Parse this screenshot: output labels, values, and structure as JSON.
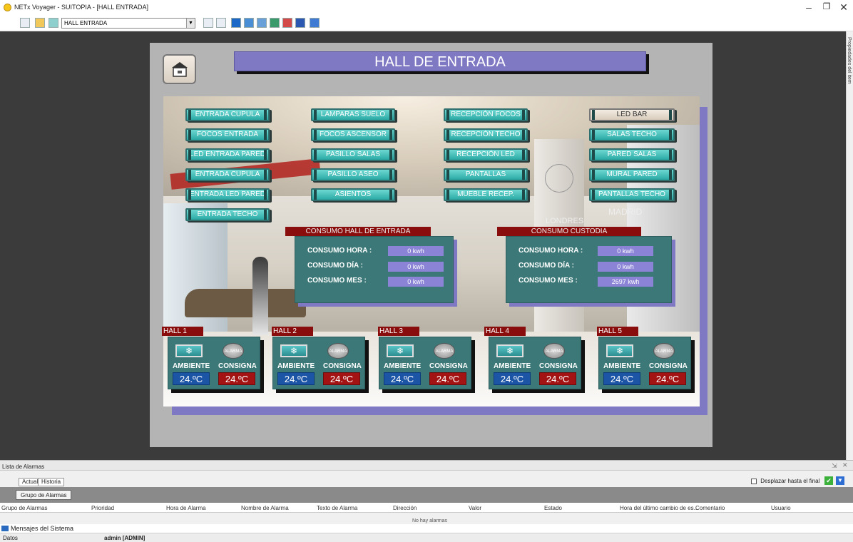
{
  "window": {
    "title": "NETx Voyager - SUITOPIA - [HALL ENTRADA]"
  },
  "toolbar": {
    "page_select": "HALL ENTRADA"
  },
  "sidebar_right": {
    "label": "Propiedades del item"
  },
  "screen": {
    "title": "HALL DE ENTRADA",
    "lights": [
      "ENTRADA CUPULA",
      "FOCOS ENTRADA",
      "LED ENTRADA PARED",
      "ENTRADA CUPULA",
      "ENTRADA LED PARED",
      "ENTRADA TECHO",
      "LAMPARAS SUELO",
      "FOCOS ASCENSOR",
      "PASILLO SALAS",
      "PASILLO ASEO",
      "ASIENTOS",
      "RECEPCIÓN FOCOS",
      "RECEPCIÓN TECHO",
      "RECEPCIÓN LED",
      "PANTALLAS",
      "MUEBLE RECEP.",
      "LED BAR",
      "SALAS TECHO",
      "PARED SALAS",
      "MURAL PARED",
      "PANTALLAS TECHO"
    ],
    "signs": {
      "londres": "LONDRES",
      "madrid": "MADRID"
    },
    "consumo_hall": {
      "title": "CONSUMO HALL DE ENTRADA",
      "labels": [
        "CONSUMO HORA :",
        "CONSUMO DÍA :",
        "CONSUMO MES :"
      ],
      "values": [
        "0 kwh",
        "0 kwh",
        "0 kwh"
      ]
    },
    "consumo_custodia": {
      "title": "CONSUMO CUSTODIA",
      "labels": [
        "CONSUMO HORA :",
        "CONSUMO DÍA :",
        "CONSUMO MES :"
      ],
      "values": [
        "0 kwh",
        "0 kwh",
        "2697 kwh"
      ]
    },
    "halls": [
      {
        "name": "HALL 1",
        "ambiente": "24.ºC",
        "consigna": "24.ºC"
      },
      {
        "name": "HALL 2",
        "ambiente": "24.ºC",
        "consigna": "24.ºC"
      },
      {
        "name": "HALL 3",
        "ambiente": "24.ºC",
        "consigna": "24.ºC"
      },
      {
        "name": "HALL 4",
        "ambiente": "24.ºC",
        "consigna": "24.ºC"
      },
      {
        "name": "HALL 5",
        "ambiente": "24.ºC",
        "consigna": "24.ºC"
      }
    ],
    "hall_labels": {
      "ambiente": "AMBIENTE",
      "consigna": "CONSIGNA",
      "alarm": "ALARMA"
    }
  },
  "alarm_pane": {
    "title": "Lista de Alarmas",
    "tabs": [
      "Actual",
      "Historia"
    ],
    "scroll_label": "Desplazar hasta el final",
    "group_tag": "Grupo de Alarmas",
    "columns": [
      "Grupo de Alarmas",
      "Prioridad",
      "Hora de Alarma",
      "Nombre de Alarma",
      "Texto de Alarma",
      "Dirección",
      "Valor",
      "Estado",
      "Hora del último cambio de es...",
      "Comentario",
      "Usuario"
    ],
    "empty_message": "No hay alarmas"
  },
  "system_messages": {
    "label": "Mensajes del Sistema"
  },
  "statusbar": {
    "datos": "Datos",
    "user": "admin [ADMIN]"
  }
}
